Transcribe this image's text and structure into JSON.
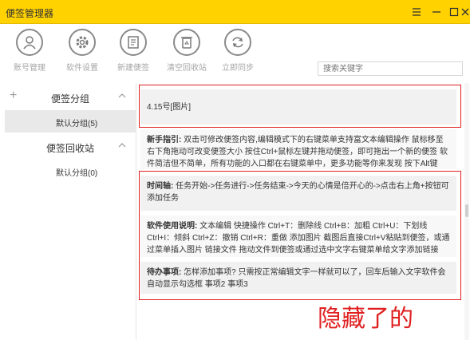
{
  "app": {
    "title": "便签管理器"
  },
  "toolbar": {
    "items": [
      {
        "label": "账号管理",
        "icon": "user-icon"
      },
      {
        "label": "软件设置",
        "icon": "gear-icon"
      },
      {
        "label": "新建便签",
        "icon": "new-note-icon"
      },
      {
        "label": "清空回收站",
        "icon": "recycle-bin-icon"
      },
      {
        "label": "立即同步",
        "icon": "sync-icon"
      }
    ],
    "search_placeholder": "搜索关键字"
  },
  "sidebar": {
    "groups": [
      {
        "label": "便签分组",
        "items": [
          {
            "label": "默认分组(5)",
            "active": true
          }
        ]
      },
      {
        "label": "便签回收站",
        "items": [
          {
            "label": "默认分组(0)",
            "active": false
          }
        ]
      }
    ]
  },
  "notes": [
    {
      "title": "",
      "body": "4.15号[图片]"
    },
    {
      "title": "新手指引:",
      "body": "双击可修改便签内容,编辑模式下的右键菜单支持富文本编辑操作 鼠标移至右下角拖动可改变便签大小 按住Ctrl+鼠标左键并拖动便签，即可拖出一个新的便签 软件简洁但不简单，所有功能的入口都在右键菜单中，更多功能等你来发现 按下Alt键"
    },
    {
      "title": "时间轴:",
      "body": "任务开始->任务进行->任务结束->今天的心情是倍开心的->点击右上角+按钮可添加任务"
    },
    {
      "title": "软件使用说明:",
      "body": "文本编辑 快捷操作 Ctrl+T：删除线 Ctrl+B：加粗 Ctrl+U：下划线 Ctrl+I：倾斜 Ctrl+Z：撤销 Ctrl+R：重做 添加图片 截图后直接Ctrl+V粘贴到便签，或通过菜单插入图片 链接文件 拖动文件到便签或通过选中文字右键菜单给文字添加链接"
    },
    {
      "title": "待办事项:",
      "body": "怎样添加事项? 只需按正常编辑文字一样就可以了，回车后输入文字软件会自动显示勾选框 事项2 事项3"
    }
  ],
  "annotation": {
    "text": "隐藏了的",
    "color": "#e02020"
  },
  "colors": {
    "titlebar": "#ffd200",
    "highlight": "#e02020"
  }
}
